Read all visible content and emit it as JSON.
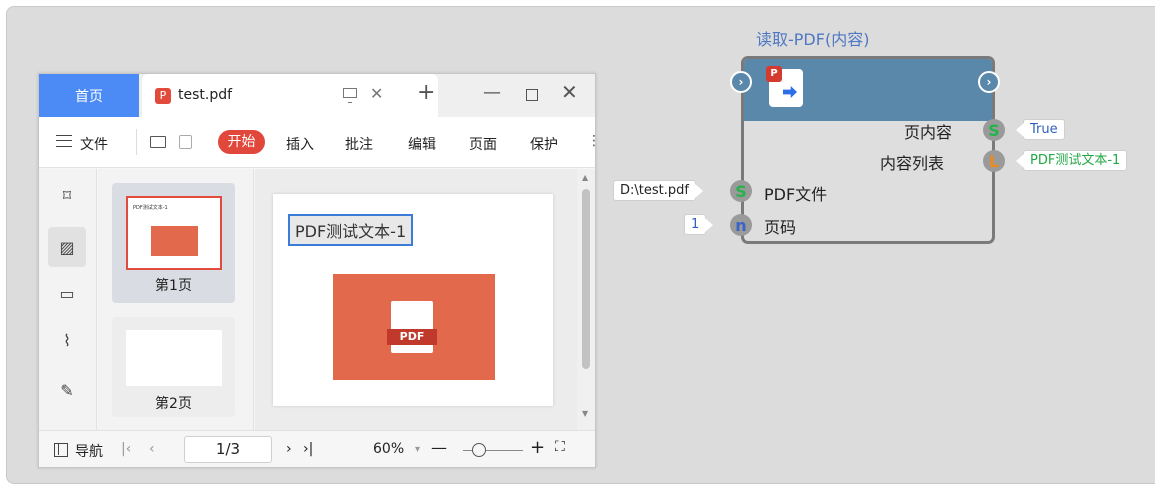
{
  "viewer": {
    "tabs": {
      "home": "首页",
      "doc_title": "test.pdf",
      "pdf_badge": "P"
    },
    "toolbar": {
      "file": "文件",
      "start": "开始",
      "insert": "插入",
      "annotate": "批注",
      "edit": "编辑",
      "page": "页面",
      "protect": "保护"
    },
    "thumbnails": [
      {
        "label": "第1页",
        "selected": true
      },
      {
        "label": "第2页",
        "selected": false
      }
    ],
    "page_content": {
      "text": "PDF测试文本-1",
      "image_label": "PDF"
    },
    "statusbar": {
      "nav": "导航",
      "page_input": "1/3",
      "zoom": "60%"
    }
  },
  "node": {
    "title": "读取-PDF(内容)",
    "icon_badge": "P",
    "outputs": [
      {
        "label": "页内容",
        "port": "S",
        "value": "True",
        "value_color": "#2e5fbf"
      },
      {
        "label": "内容列表",
        "port": "L",
        "value": "PDF测试文本-1",
        "value_color": "#22a845"
      }
    ],
    "inputs": [
      {
        "label": "PDF文件",
        "port": "S",
        "value": "D:\\test.pdf",
        "value_color": "#222222"
      },
      {
        "label": "页码",
        "port": "n",
        "value": "1",
        "value_color": "#2e5fbf"
      }
    ]
  },
  "colors": {
    "tab_home": "#4c8bf5",
    "start_button": "#e2473c",
    "node_header": "#5a88ab",
    "pdf_image": "#e2694b"
  }
}
